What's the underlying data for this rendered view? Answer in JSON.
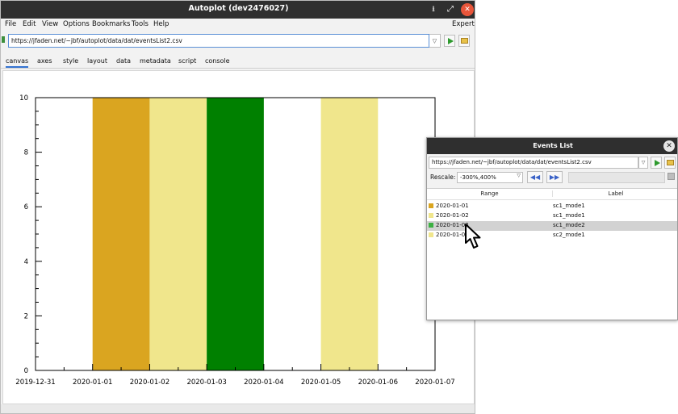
{
  "window": {
    "title": "Autoplot (dev2476027)",
    "minimize_glyph": "⭳",
    "maximize_glyph": "⤢",
    "close_glyph": "✕"
  },
  "menu": {
    "items": [
      "File",
      "Edit",
      "View",
      "Options",
      "Bookmarks",
      "Tools",
      "Help"
    ],
    "expert": "Expert"
  },
  "address": {
    "value": "https://jfaden.net/~jbf/autoplot/data/dat/eventsList2.csv",
    "dropdown_glyph": "▽",
    "play_icon": "play-icon",
    "bookmark_icon": "folder-icon"
  },
  "tabs": {
    "items": [
      "canvas",
      "axes",
      "style",
      "layout",
      "data",
      "metadata",
      "script",
      "console"
    ],
    "active": 0
  },
  "chart_data": {
    "type": "bar",
    "title": "",
    "xlabel": "",
    "ylabel": "",
    "ylim": [
      0,
      10
    ],
    "yticks": [
      "0",
      "2",
      "4",
      "6",
      "8",
      "10"
    ],
    "xlim": [
      "2019-12-31",
      "2020-01-07"
    ],
    "xticks": [
      "2019-12-31",
      "2020-01-01",
      "2020-01-02",
      "2020-01-03",
      "2020-01-04",
      "2020-01-05",
      "2020-01-06",
      "2020-01-07"
    ],
    "grid": false,
    "series": [
      {
        "start": "2020-01-01",
        "end": "2020-01-02",
        "value": 10,
        "color": "#daa520"
      },
      {
        "start": "2020-01-02",
        "end": "2020-01-03",
        "value": 10,
        "color": "#f0e68c"
      },
      {
        "start": "2020-01-03",
        "end": "2020-01-04",
        "value": 10,
        "color": "#008000"
      },
      {
        "start": "2020-01-05",
        "end": "2020-01-06",
        "value": 10,
        "color": "#f0e68c"
      }
    ]
  },
  "events": {
    "title": "Events List",
    "close_glyph": "✕",
    "url": "https://jfaden.net/~jbf/autoplot/data/dat/eventsList2.csv",
    "dropdown_glyph": "▽",
    "rescale_label": "Rescale:",
    "rescale_value": "-300%,400%",
    "rescale_drop": "▽",
    "prev_glyph": "◀◀",
    "next_glyph": "▶▶",
    "columns": [
      "Range",
      "Label"
    ],
    "rows": [
      {
        "range": "2020-01-01",
        "label": "sc1_mode1",
        "color": "#daa520",
        "selected": false
      },
      {
        "range": "2020-01-02",
        "label": "sc1_mode1",
        "color": "#f0e68c",
        "selected": false
      },
      {
        "range": "2020-01-03",
        "label": "sc1_mode2",
        "color": "#3cb043",
        "selected": true
      },
      {
        "range": "2020-01-05",
        "label": "sc2_mode1",
        "color": "#f0e68c",
        "selected": false
      }
    ]
  }
}
